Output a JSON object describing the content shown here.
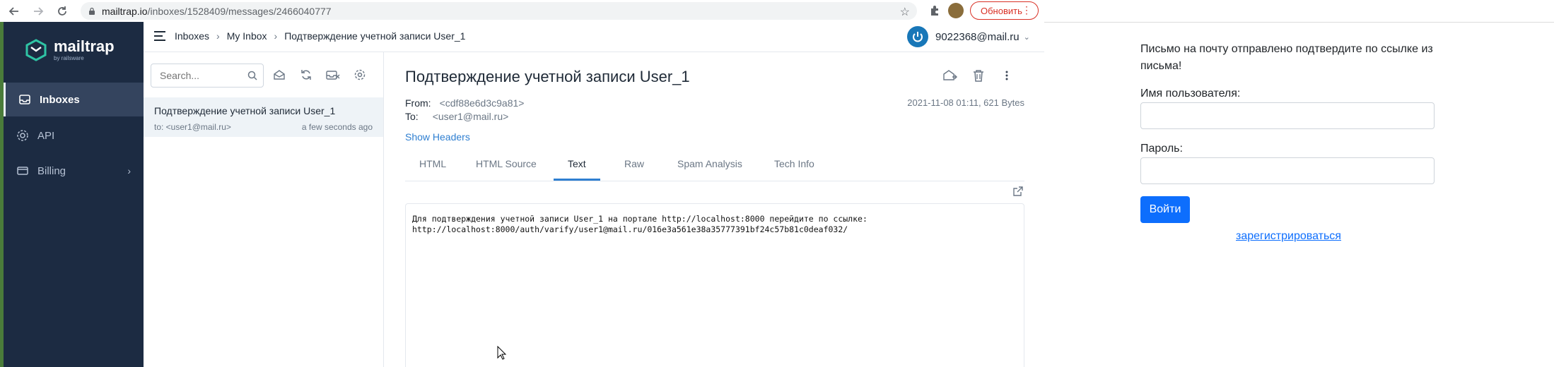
{
  "browser": {
    "url_host": "mailtrap.io",
    "url_path": "/inboxes/1528409/messages/2466040777",
    "update_label": "Обновить"
  },
  "sidebar": {
    "logo_text": "mailtrap",
    "logo_sub": "by railsware",
    "items": [
      {
        "label": "Inboxes"
      },
      {
        "label": "API"
      },
      {
        "label": "Billing"
      }
    ]
  },
  "header": {
    "crumbs": [
      "Inboxes",
      "My Inbox",
      "Подтверждение учетной записи User_1"
    ],
    "user": "9022368@mail.ru"
  },
  "list": {
    "search_placeholder": "Search...",
    "items": [
      {
        "subject": "Подтверждение учетной записи User_1",
        "to": "to: <user1@mail.ru>",
        "time": "a few seconds ago"
      }
    ]
  },
  "message": {
    "subject": "Подтверждение учетной записи User_1",
    "from_label": "From:",
    "from_value": "<cdf88e6d3c9a81>",
    "to_label": "To:",
    "to_value": "<user1@mail.ru>",
    "date_size": "2021-11-08 01:11, 621 Bytes",
    "show_headers": "Show Headers",
    "tabs": [
      "HTML",
      "HTML Source",
      "Text",
      "Raw",
      "Spam Analysis",
      "Tech Info"
    ],
    "active_tab": "Text",
    "body_line1": "Для подтверждения учетной записи User_1 на портале http://localhost:8000 перейдите по ссылке:",
    "body_line2": "http://localhost:8000/auth/varify/user1@mail.ru/016e3a561e38a35777391bf24c57b81c0deaf032/"
  },
  "login_page": {
    "notice": "Письмо на почту отправлено подтвердите по ссылке из письма!",
    "username_label": "Имя пользователя:",
    "password_label": "Пароль:",
    "submit_label": "Войти",
    "register_link": "зарегистрироваться"
  },
  "colors": {
    "sidebar_bg": "#1c2b42",
    "accent_blue": "#2f7fd1",
    "primary_btn": "#0d6efd"
  }
}
